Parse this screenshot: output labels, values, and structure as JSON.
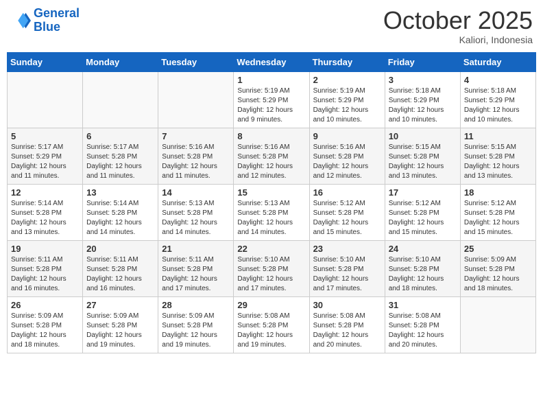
{
  "header": {
    "logo_line1": "General",
    "logo_line2": "Blue",
    "month_title": "October 2025",
    "subtitle": "Kaliori, Indonesia"
  },
  "days_of_week": [
    "Sunday",
    "Monday",
    "Tuesday",
    "Wednesday",
    "Thursday",
    "Friday",
    "Saturday"
  ],
  "weeks": [
    [
      {
        "day": "",
        "info": ""
      },
      {
        "day": "",
        "info": ""
      },
      {
        "day": "",
        "info": ""
      },
      {
        "day": "1",
        "info": "Sunrise: 5:19 AM\nSunset: 5:29 PM\nDaylight: 12 hours and 9 minutes."
      },
      {
        "day": "2",
        "info": "Sunrise: 5:19 AM\nSunset: 5:29 PM\nDaylight: 12 hours and 10 minutes."
      },
      {
        "day": "3",
        "info": "Sunrise: 5:18 AM\nSunset: 5:29 PM\nDaylight: 12 hours and 10 minutes."
      },
      {
        "day": "4",
        "info": "Sunrise: 5:18 AM\nSunset: 5:29 PM\nDaylight: 12 hours and 10 minutes."
      }
    ],
    [
      {
        "day": "5",
        "info": "Sunrise: 5:17 AM\nSunset: 5:29 PM\nDaylight: 12 hours and 11 minutes."
      },
      {
        "day": "6",
        "info": "Sunrise: 5:17 AM\nSunset: 5:28 PM\nDaylight: 12 hours and 11 minutes."
      },
      {
        "day": "7",
        "info": "Sunrise: 5:16 AM\nSunset: 5:28 PM\nDaylight: 12 hours and 11 minutes."
      },
      {
        "day": "8",
        "info": "Sunrise: 5:16 AM\nSunset: 5:28 PM\nDaylight: 12 hours and 12 minutes."
      },
      {
        "day": "9",
        "info": "Sunrise: 5:16 AM\nSunset: 5:28 PM\nDaylight: 12 hours and 12 minutes."
      },
      {
        "day": "10",
        "info": "Sunrise: 5:15 AM\nSunset: 5:28 PM\nDaylight: 12 hours and 13 minutes."
      },
      {
        "day": "11",
        "info": "Sunrise: 5:15 AM\nSunset: 5:28 PM\nDaylight: 12 hours and 13 minutes."
      }
    ],
    [
      {
        "day": "12",
        "info": "Sunrise: 5:14 AM\nSunset: 5:28 PM\nDaylight: 12 hours and 13 minutes."
      },
      {
        "day": "13",
        "info": "Sunrise: 5:14 AM\nSunset: 5:28 PM\nDaylight: 12 hours and 14 minutes."
      },
      {
        "day": "14",
        "info": "Sunrise: 5:13 AM\nSunset: 5:28 PM\nDaylight: 12 hours and 14 minutes."
      },
      {
        "day": "15",
        "info": "Sunrise: 5:13 AM\nSunset: 5:28 PM\nDaylight: 12 hours and 14 minutes."
      },
      {
        "day": "16",
        "info": "Sunrise: 5:12 AM\nSunset: 5:28 PM\nDaylight: 12 hours and 15 minutes."
      },
      {
        "day": "17",
        "info": "Sunrise: 5:12 AM\nSunset: 5:28 PM\nDaylight: 12 hours and 15 minutes."
      },
      {
        "day": "18",
        "info": "Sunrise: 5:12 AM\nSunset: 5:28 PM\nDaylight: 12 hours and 15 minutes."
      }
    ],
    [
      {
        "day": "19",
        "info": "Sunrise: 5:11 AM\nSunset: 5:28 PM\nDaylight: 12 hours and 16 minutes."
      },
      {
        "day": "20",
        "info": "Sunrise: 5:11 AM\nSunset: 5:28 PM\nDaylight: 12 hours and 16 minutes."
      },
      {
        "day": "21",
        "info": "Sunrise: 5:11 AM\nSunset: 5:28 PM\nDaylight: 12 hours and 17 minutes."
      },
      {
        "day": "22",
        "info": "Sunrise: 5:10 AM\nSunset: 5:28 PM\nDaylight: 12 hours and 17 minutes."
      },
      {
        "day": "23",
        "info": "Sunrise: 5:10 AM\nSunset: 5:28 PM\nDaylight: 12 hours and 17 minutes."
      },
      {
        "day": "24",
        "info": "Sunrise: 5:10 AM\nSunset: 5:28 PM\nDaylight: 12 hours and 18 minutes."
      },
      {
        "day": "25",
        "info": "Sunrise: 5:09 AM\nSunset: 5:28 PM\nDaylight: 12 hours and 18 minutes."
      }
    ],
    [
      {
        "day": "26",
        "info": "Sunrise: 5:09 AM\nSunset: 5:28 PM\nDaylight: 12 hours and 18 minutes."
      },
      {
        "day": "27",
        "info": "Sunrise: 5:09 AM\nSunset: 5:28 PM\nDaylight: 12 hours and 19 minutes."
      },
      {
        "day": "28",
        "info": "Sunrise: 5:09 AM\nSunset: 5:28 PM\nDaylight: 12 hours and 19 minutes."
      },
      {
        "day": "29",
        "info": "Sunrise: 5:08 AM\nSunset: 5:28 PM\nDaylight: 12 hours and 19 minutes."
      },
      {
        "day": "30",
        "info": "Sunrise: 5:08 AM\nSunset: 5:28 PM\nDaylight: 12 hours and 20 minutes."
      },
      {
        "day": "31",
        "info": "Sunrise: 5:08 AM\nSunset: 5:28 PM\nDaylight: 12 hours and 20 minutes."
      },
      {
        "day": "",
        "info": ""
      }
    ]
  ]
}
